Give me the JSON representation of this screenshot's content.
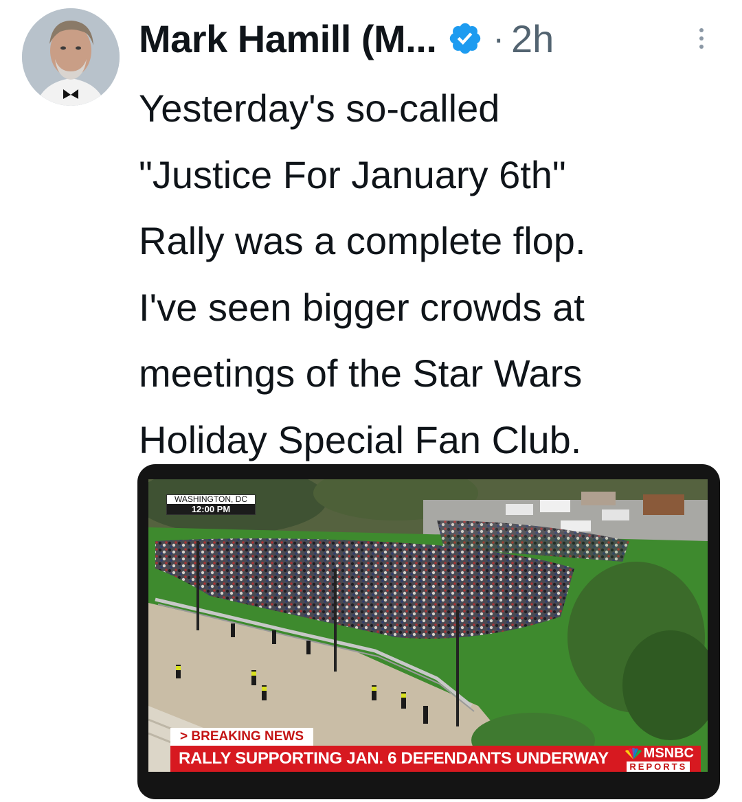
{
  "tweet": {
    "author_name": "Mark Hamill (M...",
    "verified": true,
    "separator": "·",
    "timestamp": "2h",
    "text": "Yesterday's so-called\n\"Justice For January 6th\"\nRally was a complete flop.\nI've seen bigger crowds at\nmeetings of the Star Wars\nHoliday Special Fan Club."
  },
  "icons": {
    "verified": "verified-badge-icon",
    "more": "more-options-icon"
  },
  "colors": {
    "text": "#0f1419",
    "secondary": "#536471",
    "verified_blue": "#1d9bf0",
    "msnbc_red": "#d71920"
  },
  "media": {
    "location": "WASHINGTON, DC",
    "time": "12:00 PM",
    "breaking": "> BREAKING NEWS",
    "headline": "RALLY SUPPORTING JAN. 6 DEFENDANTS UNDERWAY",
    "network": "MSNBC",
    "network_sub": "REPORTS"
  }
}
